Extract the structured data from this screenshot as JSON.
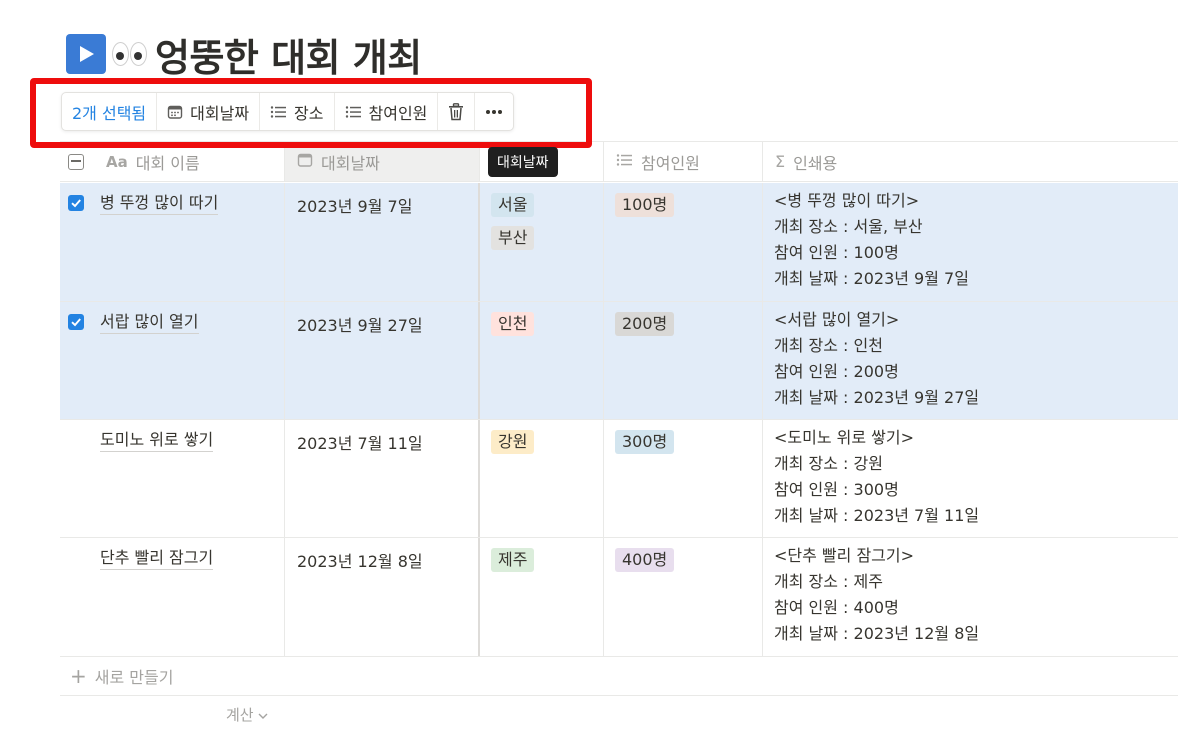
{
  "page": {
    "title": "엉뚱한 대회 개최",
    "play_icon": "play-button-icon",
    "eyes_icon": "eyes-icon"
  },
  "action_bar": {
    "selected_label": "2개 선택됨",
    "date_label": "대회날짜",
    "place_label": "장소",
    "people_label": "참여인원"
  },
  "tooltip": "대회날짜",
  "columns": {
    "name": "대회 이름",
    "name_icon_text": "Aa",
    "date": "대회날짜",
    "place": "장소",
    "people": "참여인원",
    "print": "인쇄용",
    "print_icon_text": "Σ"
  },
  "rows": [
    {
      "selected": true,
      "name": "병 뚜껑 많이 따기",
      "date": "2023년 9월 7일",
      "places": [
        "서울",
        "부산"
      ],
      "people": "100명",
      "print": [
        "<병 뚜껑 많이 따기>",
        "개최 장소 : 서울, 부산",
        "참여 인원 : 100명",
        "개최 날짜 : 2023년 9월 7일"
      ]
    },
    {
      "selected": true,
      "name": "서랍 많이 열기",
      "date": "2023년 9월 27일",
      "places": [
        "인천"
      ],
      "people": "200명",
      "print": [
        "<서랍 많이 열기>",
        "개최 장소 : 인천",
        "참여 인원 : 200명",
        "개최 날짜 : 2023년 9월 27일"
      ]
    },
    {
      "selected": false,
      "name": "도미노 위로 쌓기",
      "date": "2023년 7월 11일",
      "places": [
        "강원"
      ],
      "people": "300명",
      "print": [
        "<도미노 위로 쌓기>",
        "개최 장소 : 강원",
        "참여 인원 : 300명",
        "개최 날짜 : 2023년 7월 11일"
      ]
    },
    {
      "selected": false,
      "name": "단추 빨리 잠그기",
      "date": "2023년 12월 8일",
      "places": [
        "제주"
      ],
      "people": "400명",
      "print": [
        "<단추 빨리 잠그기>",
        "개최 장소 : 제주",
        "참여 인원 : 400명",
        "개최 날짜 : 2023년 12월 8일"
      ]
    }
  ],
  "new_row_label": "새로 만들기",
  "calc_label": "계산",
  "colors": {
    "accent": "#2383e2",
    "selected_row": "#e2ecf8",
    "highlight_box": "#ee0d0d"
  }
}
